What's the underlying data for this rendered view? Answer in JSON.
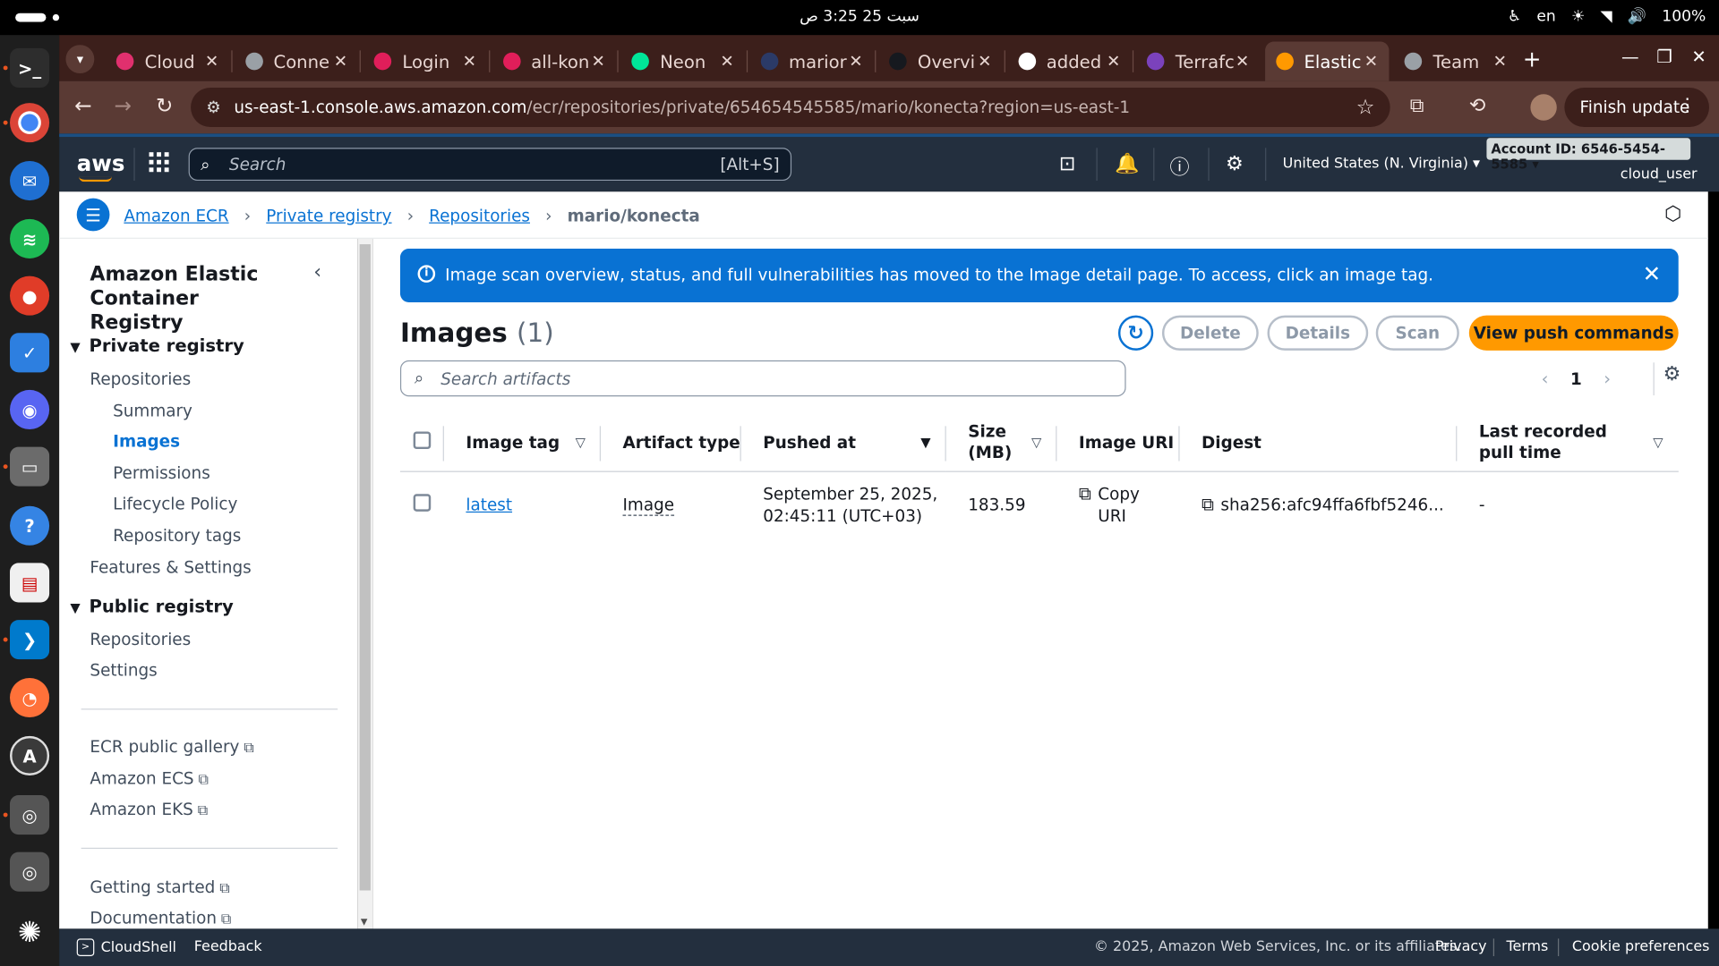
{
  "system": {
    "date_time": "سبت 25  3:25 ص",
    "lang": "en",
    "battery": "100%"
  },
  "browser": {
    "tabs": [
      {
        "title": "Cloud",
        "icon_color": "#e0306e"
      },
      {
        "title": "Conne",
        "icon_color": "#9aa0a6"
      },
      {
        "title": "Login",
        "icon_color": "#e01e5a"
      },
      {
        "title": "all-kon",
        "icon_color": "#e01e5a"
      },
      {
        "title": "Neon",
        "icon_color": "#00e599"
      },
      {
        "title": "marior",
        "icon_color": "#2b3a67"
      },
      {
        "title": "Overvi",
        "icon_color": "#16191f"
      },
      {
        "title": "added",
        "icon_color": "#ffffff"
      },
      {
        "title": "Terrafc",
        "icon_color": "#7b42bc"
      },
      {
        "title": "Elastic",
        "icon_color": "#ff9900"
      },
      {
        "title": "Team",
        "icon_color": "#9aa0a6"
      }
    ],
    "active_tab_index": 9,
    "url_host": "us-east-1.console.aws.amazon.com",
    "url_path": "/ecr/repositories/private/654654545585/mario/konecta?region=us-east-1",
    "finish_update": "Finish update"
  },
  "aws": {
    "search_placeholder": "Search",
    "search_shortcut": "[Alt+S]",
    "region": "United States (N. Virginia)",
    "account": "Account ID: 6546-5454-5585",
    "user": "cloud_user"
  },
  "breadcrumb": {
    "items": [
      "Amazon ECR",
      "Private registry",
      "Repositories"
    ],
    "current": "mario/konecta"
  },
  "sidenav": {
    "title": "Amazon Elastic Container Registry",
    "private_section": "Private registry",
    "private_items": [
      "Repositories"
    ],
    "repo_sub_items": [
      "Summary",
      "Images",
      "Permissions",
      "Lifecycle Policy",
      "Repository tags"
    ],
    "active_sub_item": "Images",
    "features_item": "Features & Settings",
    "public_section": "Public registry",
    "public_items": [
      "Repositories",
      "Settings"
    ],
    "external_links": [
      "ECR public gallery",
      "Amazon ECS",
      "Amazon EKS"
    ],
    "help_links": [
      "Getting started",
      "Documentation"
    ]
  },
  "main": {
    "flash_message": "Image scan overview, status, and full vulnerabilities has moved to the Image detail page. To access, click an image tag.",
    "header_title": "Images",
    "header_count": "(1)",
    "buttons": {
      "delete": "Delete",
      "details": "Details",
      "scan": "Scan",
      "push": "View push commands"
    },
    "search_placeholder": "Search artifacts",
    "page_number": "1",
    "columns": {
      "image_tag": "Image tag",
      "artifact_type": "Artifact type",
      "pushed_at": "Pushed at",
      "size": "Size (MB)",
      "image_uri": "Image URI",
      "digest": "Digest",
      "last_pull": "Last recorded pull time"
    },
    "rows": [
      {
        "image_tag": "latest",
        "artifact_type": "Image",
        "pushed_at_line1": "September 25, 2025,",
        "pushed_at_line2": "02:45:11 (UTC+03)",
        "size": "183.59",
        "uri_line1": "Copy",
        "uri_line2": "URI",
        "digest": "sha256:afc94ffa6fbf5246...",
        "last_pull": "-"
      }
    ]
  },
  "footer": {
    "cloudshell": "CloudShell",
    "feedback": "Feedback",
    "copyright": "© 2025, Amazon Web Services, Inc. or its affiliates.",
    "privacy": "Privacy",
    "terms": "Terms",
    "cookies": "Cookie preferences"
  }
}
